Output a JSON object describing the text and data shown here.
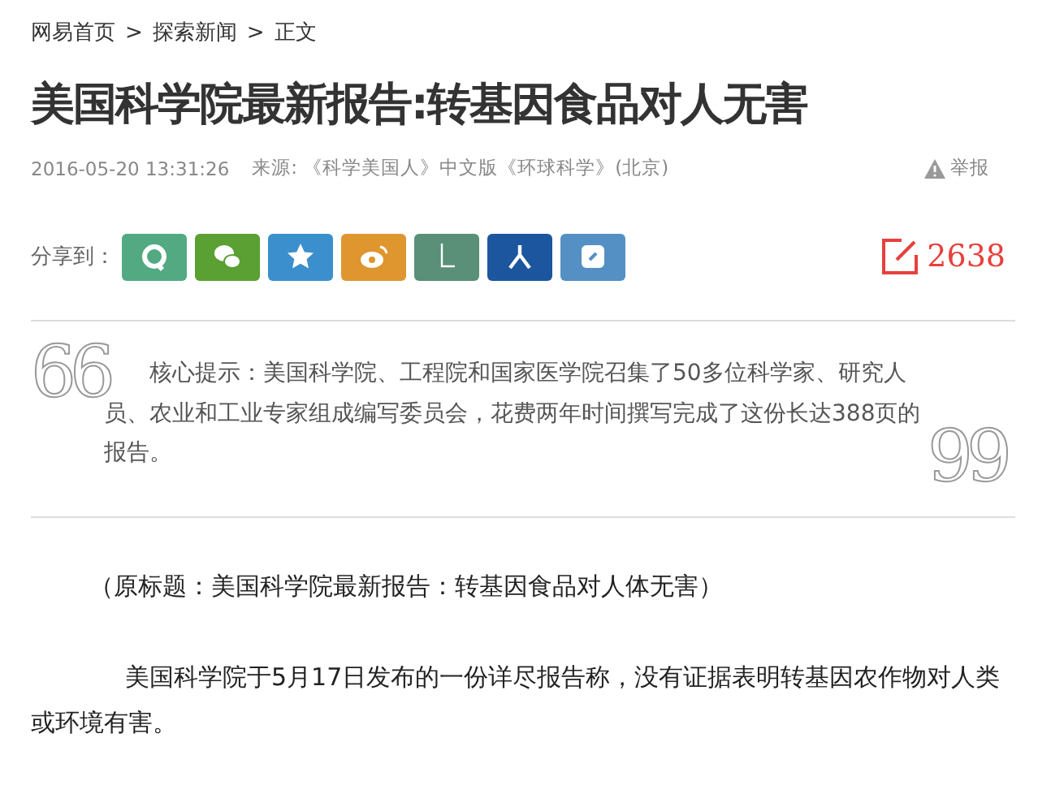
{
  "breadcrumb": {
    "items": [
      "网易首页",
      "探索新闻",
      "正文"
    ],
    "separator": ">"
  },
  "article": {
    "title": "美国科学院最新报告:转基因食品对人无害",
    "date": "2016-05-20 13:31:26",
    "source": "来源: 《科学美国人》中文版《环球科学》(北京)",
    "report": "举报"
  },
  "share": {
    "label": "分享到：",
    "buttons": [
      {
        "kind": "ring",
        "color": "#52a982"
      },
      {
        "kind": "chat",
        "color": "#5aa032"
      },
      {
        "kind": "star",
        "color": "#3b8fcc"
      },
      {
        "kind": "eye",
        "color": "#df962f"
      },
      {
        "kind": "stroke",
        "color": "#5a8f78"
      },
      {
        "kind": "person",
        "color": "#1c569e"
      },
      {
        "kind": "note",
        "color": "#5590c4"
      }
    ],
    "comments": "2638"
  },
  "summary": {
    "open_quote": "66",
    "text": "核心提示：美国科学院、工程院和国家医学院召集了50多位科学家、研究人员、农业和工业专家组成编写委员会，花费两年时间撰写完成了这份长达388页的报告。",
    "close_quote": "99"
  },
  "body": [
    "（原标题：美国科学院最新报告：转基因食品对人体无害）",
    "美国科学院于5月17日发布的一份详尽报告称，没有证据表明转基因农作物对人类或环境有害。"
  ]
}
